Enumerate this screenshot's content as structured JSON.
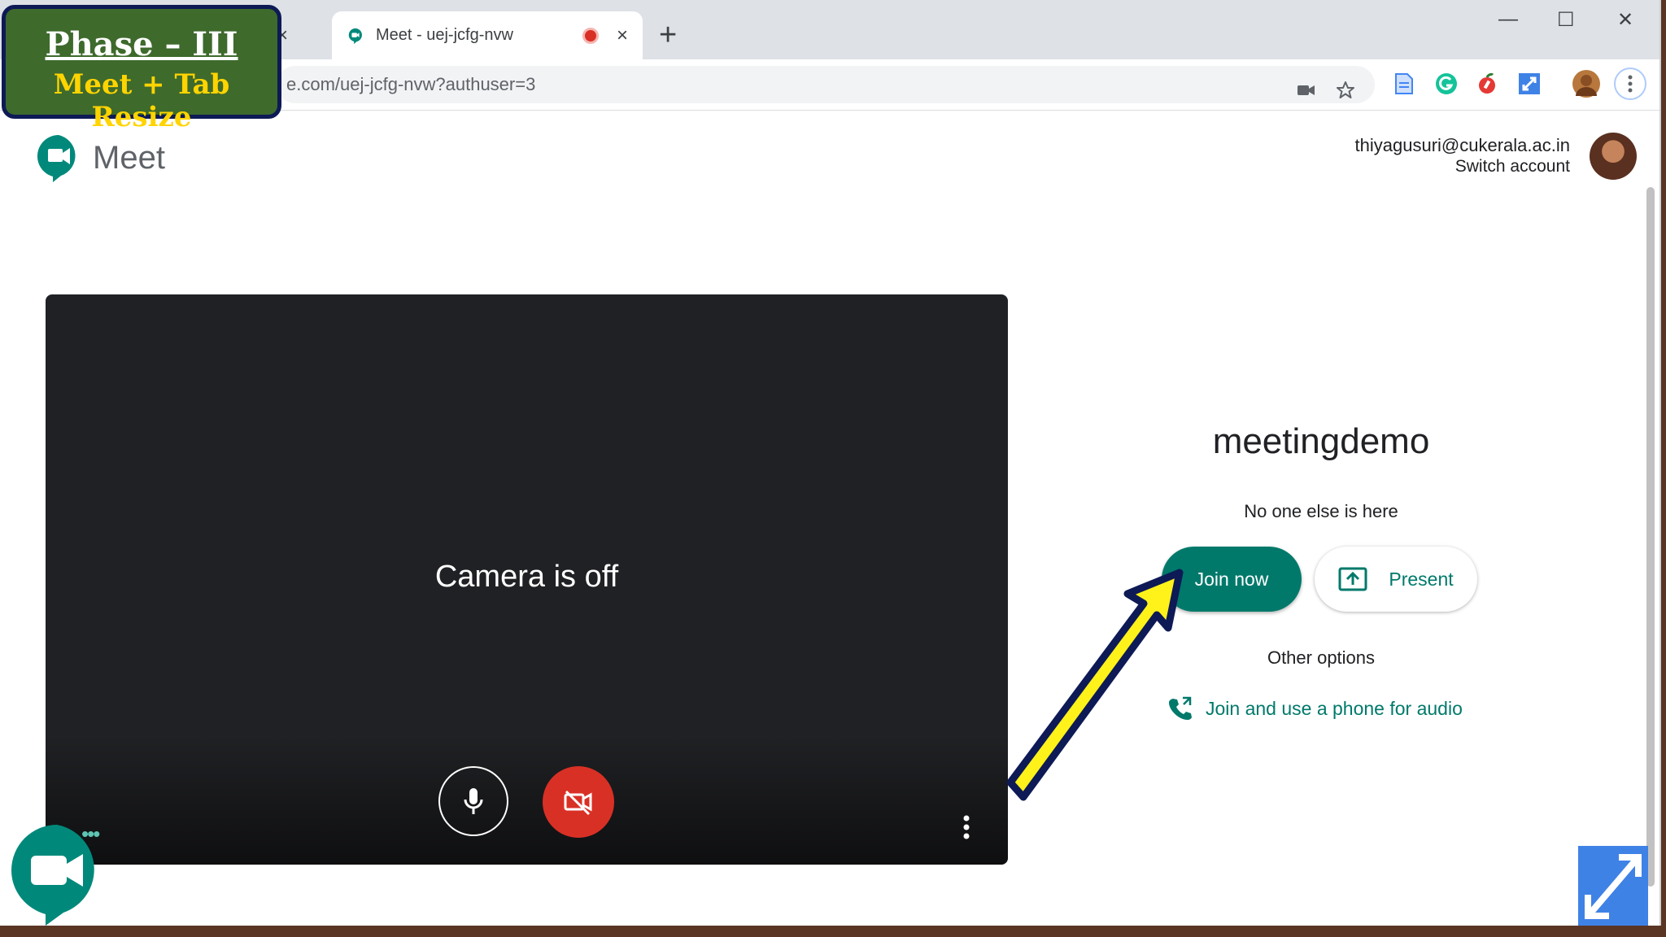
{
  "overlay": {
    "title": "Phase – III",
    "subtitle": "Meet + Tab Resize"
  },
  "browser": {
    "active_tab_title": "Meet - uej-jcfg-nvw",
    "close_symbol": "×",
    "new_tab_symbol": "+",
    "url": "e.com/uej-jcfg-nvw?authuser=3",
    "window_controls": {
      "minimize": "—",
      "maximize": "☐",
      "close": "✕"
    }
  },
  "header": {
    "app_name": "Meet",
    "account_email": "thiyagusuri@cukerala.ac.in",
    "switch_account": "Switch account"
  },
  "preview": {
    "camera_status": "Camera is off"
  },
  "join_panel": {
    "meeting_name": "meetingdemo",
    "participants_status": "No one else is here",
    "join_button": "Join now",
    "present_button": "Present",
    "other_options": "Other options",
    "phone_audio_link": "Join and use a phone for audio"
  },
  "colors": {
    "meet_green": "#00796b",
    "recording_red": "#d93025",
    "overlay_bg": "#3e6a2c",
    "overlay_text": "#ffd400"
  },
  "icons": [
    "meet-favicon",
    "recording-icon",
    "camera-icon",
    "star-icon",
    "docs-icon",
    "grammarly-icon",
    "extension-icon",
    "resize-icon",
    "profile-avatar",
    "menu-icon",
    "mic-icon",
    "camera-off-icon",
    "more-vert-icon",
    "present-icon",
    "phone-icon",
    "arrow-annotation"
  ]
}
